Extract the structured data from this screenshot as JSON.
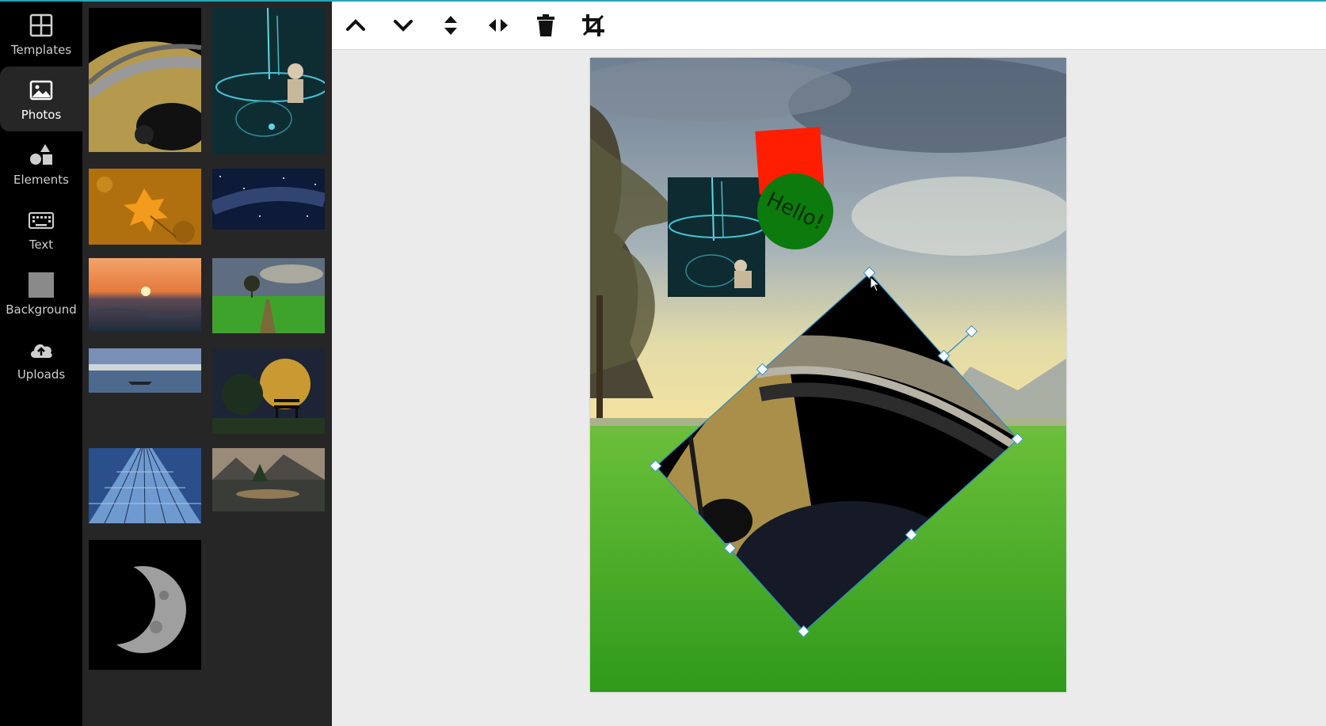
{
  "nav": {
    "items": [
      {
        "label": "Templates",
        "icon": "grid-icon"
      },
      {
        "label": "Photos",
        "icon": "image-icon",
        "active": true
      },
      {
        "label": "Elements",
        "icon": "shapes-icon"
      },
      {
        "label": "Text",
        "icon": "keyboard-icon"
      },
      {
        "label": "Background",
        "icon": "square-icon"
      },
      {
        "label": "Uploads",
        "icon": "cloud-upload-icon"
      }
    ]
  },
  "toolbar": {
    "tools": [
      {
        "name": "move-up-button",
        "icon": "chevron-up-icon"
      },
      {
        "name": "move-down-button",
        "icon": "chevron-down-icon"
      },
      {
        "name": "flip-vertical-button",
        "icon": "flip-vertical-icon"
      },
      {
        "name": "flip-horizontal-button",
        "icon": "flip-horizontal-icon"
      },
      {
        "name": "delete-button",
        "icon": "trash-icon"
      },
      {
        "name": "crop-button",
        "icon": "crop-icon"
      }
    ]
  },
  "photos": [
    "saturn-rings-photo",
    "neon-figure-photo",
    "autumn-leaf-photo",
    "milky-way-photo",
    "ocean-sunset-photo",
    "green-field-tree-photo",
    "harbor-lake-photo",
    "full-moon-bench-photo",
    "glass-skyscraper-photo",
    "mountain-lake-photo",
    "half-moon-photo"
  ],
  "canvas": {
    "hello_text": "Hello!",
    "colors": {
      "red_square": "#ff1f00",
      "green_circle": "#0c7a0c",
      "selection": "#2a8ec7"
    }
  }
}
